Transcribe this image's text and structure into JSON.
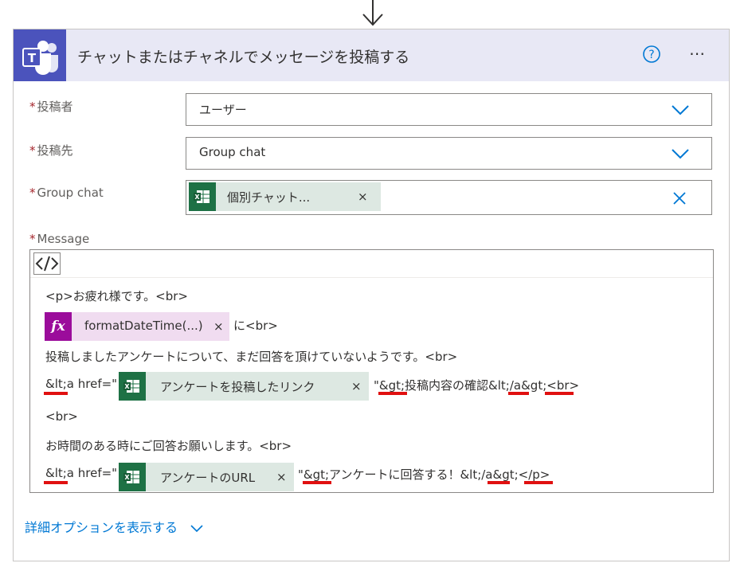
{
  "card": {
    "title": "チャットまたはチャネルでメッセージを投稿する",
    "more_label": "⋯"
  },
  "fields": {
    "poster": {
      "label": "投稿者",
      "value": "ユーザー"
    },
    "post_to": {
      "label": "投稿先",
      "value": "Group chat"
    },
    "group_chat": {
      "label": "Group chat",
      "token": "個別チャット..."
    },
    "message": {
      "label": "Message"
    }
  },
  "message": {
    "line1": "<p>お疲れ様です。<br>",
    "fx_token": "formatDateTime(...)",
    "line2_suffix": "に<br>",
    "line3": "投稿しましたアンケートについて、まだ回答を頂けていないようです。<br>",
    "line4_prefix": "&lt;a href=\"",
    "line4_token": "アンケートを投稿したリンク",
    "line4_suffix": "\"&gt;投稿内容の確認&lt;/a&gt;<br>",
    "line5": "<br>",
    "line6": "お時間のある時にご回答お願いします。<br>",
    "line7_prefix": "&lt;a href=\"",
    "line7_token": "アンケートのURL",
    "line7_suffix": "\"&gt;アンケートに回答する！&lt;/a&gt;</p>"
  },
  "token_close": "×",
  "advanced_options": "詳細オプションを表示する",
  "colors": {
    "teams_purple": "#4b53bc",
    "header_bg": "#e8e8f5",
    "excel_green": "#1e7145",
    "link_blue": "#0078d4",
    "required_red": "#a4262c",
    "underline_red": "#e01010"
  },
  "icons": [
    "down-arrow-icon",
    "teams-icon",
    "help-icon",
    "more-icon",
    "chevron-down-icon",
    "clear-icon",
    "excel-icon",
    "fx-icon",
    "code-view-icon"
  ]
}
